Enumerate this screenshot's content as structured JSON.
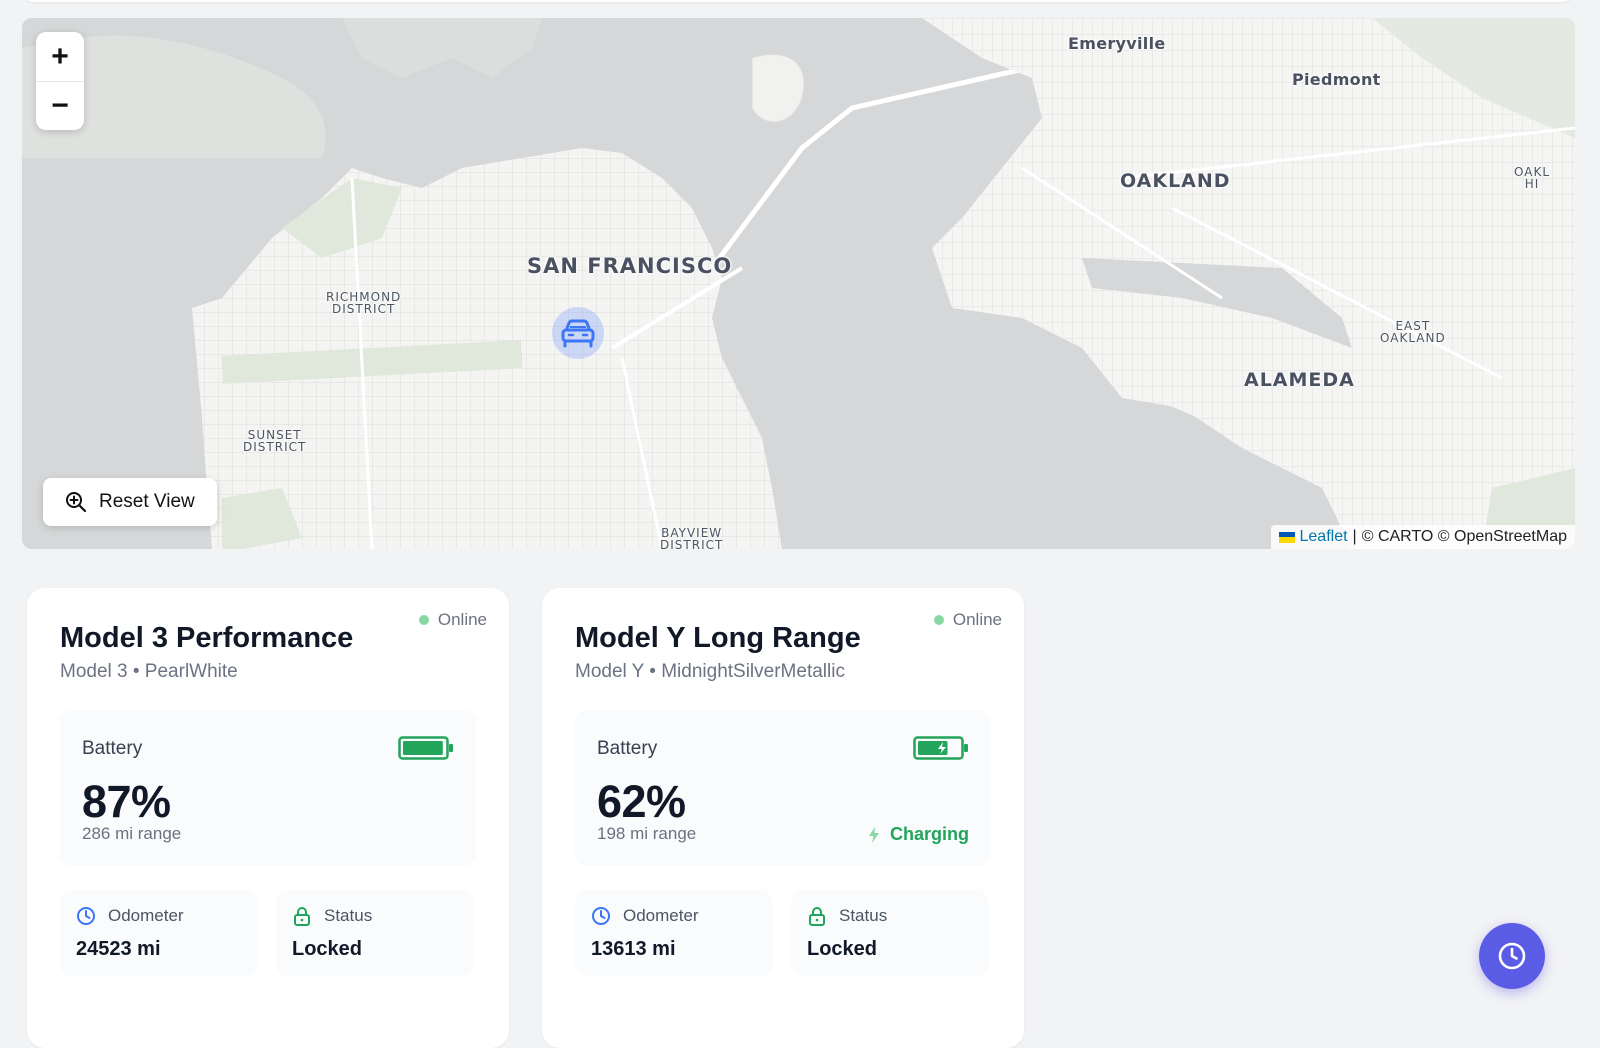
{
  "map": {
    "zoom_in": "+",
    "zoom_out": "−",
    "reset_view": "Reset View",
    "attribution": {
      "leaflet": "Leaflet",
      "separator": "|",
      "credits": "© CARTO © OpenStreetMap"
    },
    "labels": {
      "san_francisco": "SAN FRANCISCO",
      "oakland": "OAKLAND",
      "alameda": "ALAMEDA",
      "emeryville": "Emeryville",
      "piedmont": "Piedmont",
      "richmond_1": "RICHMOND",
      "richmond_2": "DISTRICT",
      "sunset_1": "SUNSET",
      "sunset_2": "DISTRICT",
      "east_oakland_1": "EAST",
      "east_oakland_2": "OAKLAND",
      "bayview_1": "BAYVIEW",
      "bayview_2": "DISTRICT",
      "edge_1": "OAKL",
      "edge_2": "HI"
    },
    "colors": {
      "water": "#d5d7d8",
      "land": "#f2f2f0",
      "park": "#dde7d8",
      "marker": "#3b76f6"
    }
  },
  "vehicles": [
    {
      "name": "Model 3 Performance",
      "subtitle": "Model 3 • PearlWhite",
      "status": "Online",
      "battery_label": "Battery",
      "battery_level": 0.87,
      "battery_pct": "87%",
      "range": "286 mi range",
      "charging": "",
      "odometer_label": "Odometer",
      "odometer": "24523 mi",
      "status_label": "Status",
      "lock_status": "Locked"
    },
    {
      "name": "Model Y Long Range",
      "subtitle": "Model Y • MidnightSilverMetallic",
      "status": "Online",
      "battery_label": "Battery",
      "battery_level": 0.62,
      "battery_pct": "62%",
      "range": "198 mi range",
      "charging": "Charging",
      "odometer_label": "Odometer",
      "odometer": "13613 mi",
      "status_label": "Status",
      "lock_status": "Locked"
    }
  ],
  "icons": {
    "zoom": "magnifier-plus-icon",
    "car": "car-icon",
    "battery": "battery-icon",
    "bolt": "lightning-bolt-icon",
    "clock": "clock-icon",
    "lock": "lock-icon"
  },
  "colors": {
    "accent": "#5b5ce6",
    "green": "#22a55a",
    "blue": "#3b76f6"
  }
}
